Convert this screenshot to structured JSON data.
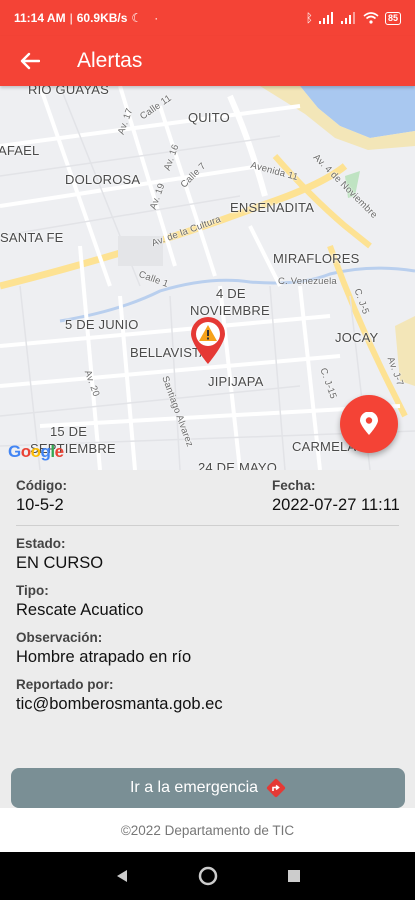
{
  "status_bar": {
    "time": "11:14 AM",
    "network_speed": "60.9KB/s",
    "battery": "85"
  },
  "app_bar": {
    "title": "Alertas"
  },
  "map": {
    "labels": [
      "RIO GUAYAS",
      "QUITO",
      "AFAEL",
      "DOLOROSA",
      "ENSENADITA",
      "SANTA FE",
      "MIRAFLORES",
      "4 DE",
      "NOVIEMBRE",
      "5 DE JUNIO",
      "JOCAY",
      "BELLAVISTA",
      "JIPIJAPA",
      "15 DE",
      "SEPTIEMBRE",
      "CARMELA",
      "24 DE MAYO"
    ],
    "street_labels": [
      "Av. 17",
      "Calle 11",
      "Av. 16",
      "Calle 7",
      "Av. 19",
      "Av. de la Cultura",
      "Avenida 11",
      "Av. 4 de Noviembre",
      "Calle 1",
      "C. Venezuela",
      "C. J-5",
      "Av. 20",
      "Santiago Alvarez",
      "C. J-15",
      "Av. J-7"
    ],
    "logo": "Google"
  },
  "alert": {
    "codigo_label": "Código:",
    "codigo": "10-5-2",
    "fecha_label": "Fecha:",
    "fecha": "2022-07-27 11:11",
    "estado_label": "Estado:",
    "estado": "EN CURSO",
    "tipo_label": "Tipo:",
    "tipo": "Rescate Acuatico",
    "observacion_label": "Observación:",
    "observacion": "Hombre atrapado en río",
    "reportado_label": "Reportado por:",
    "reportado": "tic@bomberosmanta.gob.ec"
  },
  "button": {
    "label": "Ir a la emergencia"
  },
  "footer": {
    "text": "©2022 Departamento de TIC"
  },
  "colors": {
    "primary": "#f44336",
    "button": "#7a8f95",
    "water": "#a9c8f0",
    "road_yellow": "#fde293"
  }
}
